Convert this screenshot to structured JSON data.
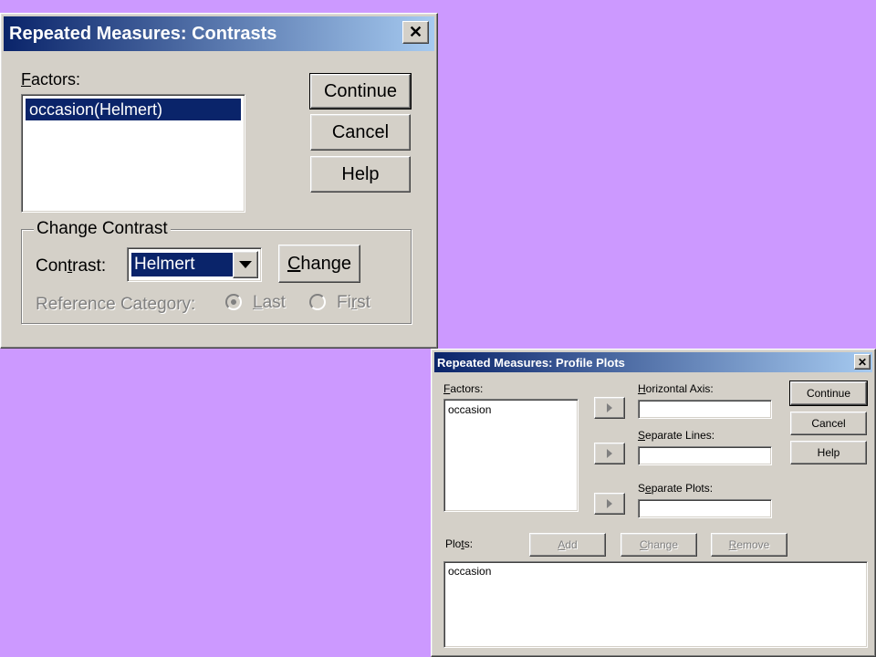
{
  "contrasts_dialog": {
    "title": "Repeated Measures: Contrasts",
    "close_glyph": "✕",
    "factors_label": "Factors:",
    "factors_list": [
      "occasion(Helmert)"
    ],
    "buttons": {
      "continue": "Continue",
      "cancel": "Cancel",
      "help": "Help"
    },
    "change_contrast_group": "Change Contrast",
    "contrast_label": "Contrast:",
    "contrast_value": "Helmert",
    "change_button": "Change",
    "reference_category_label": "Reference Category:",
    "radio_last": "Last",
    "radio_first": "First",
    "selected_reference": "Last"
  },
  "profile_plots_dialog": {
    "title": "Repeated Measures: Profile Plots",
    "close_glyph": "✕",
    "factors_label": "Factors:",
    "factors_list": [
      "occasion"
    ],
    "horizontal_axis_label": "Horizontal Axis:",
    "horizontal_axis_value": "",
    "separate_lines_label": "Separate Lines:",
    "separate_lines_value": "",
    "separate_plots_label": "Separate Plots:",
    "separate_plots_value": "",
    "buttons": {
      "continue": "Continue",
      "cancel": "Cancel",
      "help": "Help"
    },
    "plots_label": "Plots:",
    "add_button": "Add",
    "change_button": "Change",
    "remove_button": "Remove",
    "plots_list": [
      "occasion"
    ]
  },
  "colors": {
    "desktop": "#cc99ff",
    "dialog_face": "#d4d0c8",
    "title_start": "#0a246a",
    "title_end": "#a6caf0",
    "selection": "#0a246a"
  }
}
